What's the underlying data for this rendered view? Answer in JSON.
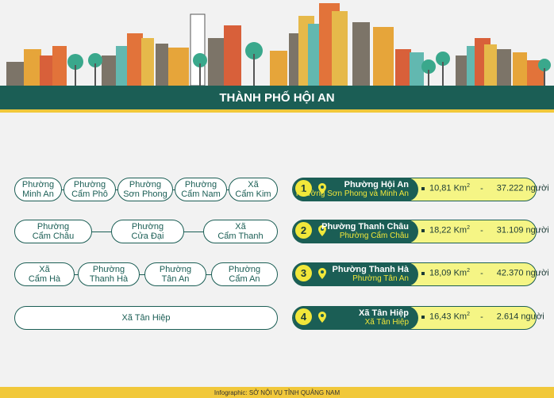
{
  "title": "THÀNH PHỐ HỘI AN",
  "footer": "Infographic: SỞ NỘI VỤ TỈNH QUẢNG NAM",
  "colors": {
    "dark_green": "#1b5e55",
    "yellow": "#f1e73a",
    "light_yellow": "#f5f585",
    "gold": "#f1c83a"
  },
  "rows": [
    {
      "sources": [
        {
          "line1": "Phường",
          "line2": "Minh An"
        },
        {
          "line1": "Phường",
          "line2": "Cẩm Phô"
        },
        {
          "line1": "Phường",
          "line2": "Sơn Phong"
        },
        {
          "line1": "Phường",
          "line2": "Cẩm Nam"
        },
        {
          "line1": "Xã",
          "line2": "Cẩm Kim"
        }
      ],
      "number": "1",
      "name": "Phường Hội An",
      "sub": "Phường Sơn Phong và Minh An",
      "area_value": "10,81 Km",
      "area_exp": "2",
      "sep": "-",
      "population": "37.222 người",
      "icon": "location-pin-icon"
    },
    {
      "sources": [
        {
          "line1": "Phường",
          "line2": "Cẩm Châu"
        },
        {
          "line1": "Phường",
          "line2": "Cửa Đại"
        },
        {
          "line1": "Xã",
          "line2": "Cẩm Thanh"
        }
      ],
      "number": "2",
      "name": "Phường Thanh Châu",
      "sub": "Phường Cẩm Châu",
      "area_value": "18,22 Km",
      "area_exp": "2",
      "sep": "-",
      "population": "31.109 người",
      "icon": "location-pin-icon"
    },
    {
      "sources": [
        {
          "line1": "Xã",
          "line2": "Cẩm Hà"
        },
        {
          "line1": "Phường",
          "line2": "Thanh Hà"
        },
        {
          "line1": "Phường",
          "line2": "Tân An"
        },
        {
          "line1": "Phường",
          "line2": "Cẩm An"
        }
      ],
      "number": "3",
      "name": "Phường Thanh Hà",
      "sub": "Phường Tân An",
      "area_value": "18,09 Km",
      "area_exp": "2",
      "sep": "-",
      "population": "42.370 người",
      "icon": "location-pin-icon"
    },
    {
      "sources": [
        {
          "line1": "Xã Tân Hiệp",
          "line2": ""
        }
      ],
      "number": "4",
      "name": "Xã Tân Hiệp",
      "sub": "Xã Tân Hiệp",
      "area_value": "16,43 Km",
      "area_exp": "2",
      "sep": "-",
      "population": "2.614 người",
      "icon": "location-pin-icon"
    }
  ]
}
